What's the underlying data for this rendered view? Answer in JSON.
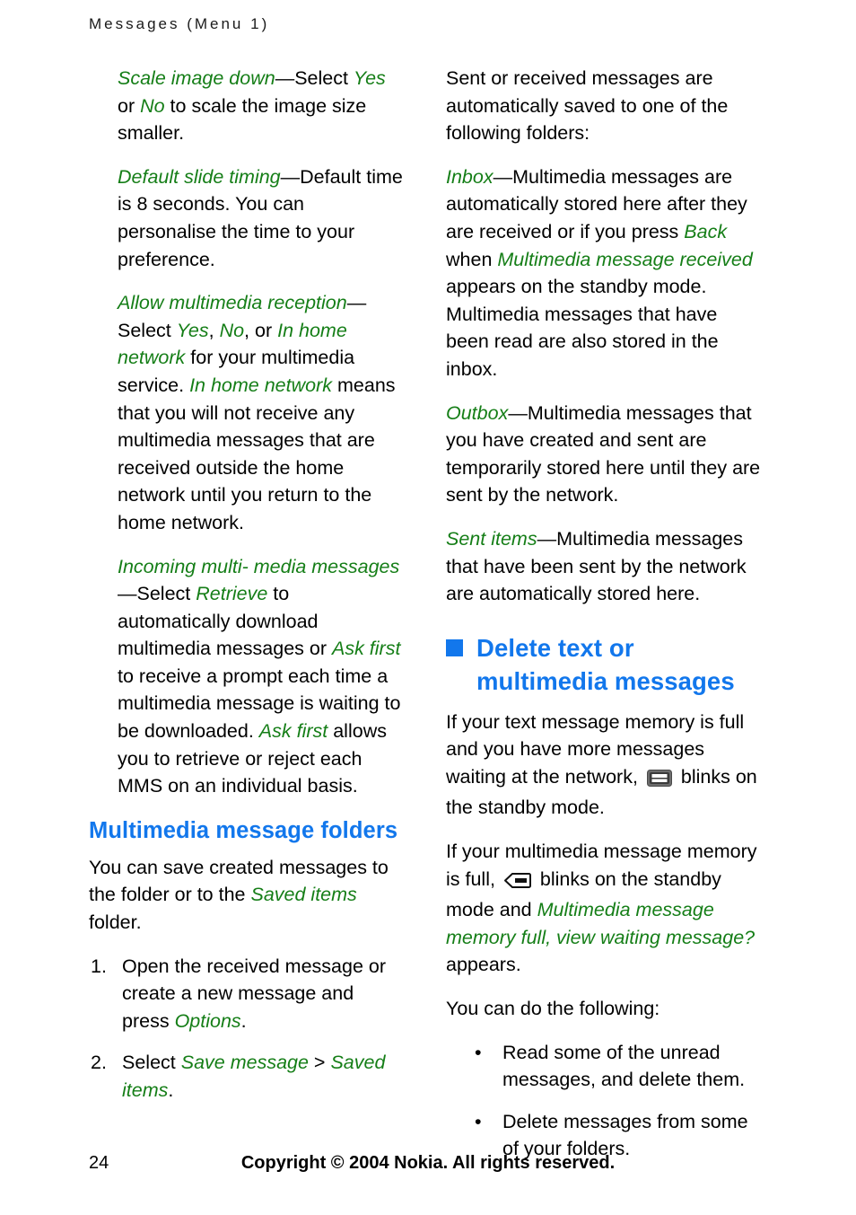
{
  "header": {
    "running_title": "Messages (Menu 1)"
  },
  "colors": {
    "green_term": "#157E17",
    "blue_heading": "#1277EC",
    "body_text": "#000000"
  },
  "left_column": {
    "paragraphs": [
      {
        "id": "scale-image-down",
        "term": "Scale image down",
        "dash": "—",
        "segments": [
          {
            "text": "Select ",
            "style": "normal"
          },
          {
            "text": "Yes",
            "style": "term"
          },
          {
            "text": " or ",
            "style": "normal"
          },
          {
            "text": "No",
            "style": "term"
          },
          {
            "text": " to scale the image size smaller.",
            "style": "normal"
          }
        ]
      },
      {
        "id": "default-slide-timing",
        "term": "Default slide timing",
        "dash": "—",
        "segments": [
          {
            "text": "Default time is 8 seconds. You can personalise the time to your preference.",
            "style": "normal"
          }
        ]
      },
      {
        "id": "allow-multimedia-reception",
        "term": "Allow multimedia reception",
        "dash": "—",
        "segments": [
          {
            "text": "Select ",
            "style": "normal"
          },
          {
            "text": "Yes",
            "style": "term"
          },
          {
            "text": ", ",
            "style": "normal"
          },
          {
            "text": "No",
            "style": "term"
          },
          {
            "text": ", or ",
            "style": "normal"
          },
          {
            "text": "In home network",
            "style": "term"
          },
          {
            "text": " for your multimedia service. ",
            "style": "normal"
          },
          {
            "text": "In home network",
            "style": "term"
          },
          {
            "text": " means that you will not receive any multimedia messages that are received outside the home network until you return to the home network.",
            "style": "normal"
          }
        ]
      },
      {
        "id": "incoming-multimedia-messages",
        "term": "Incoming multi- media messages",
        "dash": "—",
        "segments": [
          {
            "text": "Select ",
            "style": "normal"
          },
          {
            "text": "Retrieve",
            "style": "term"
          },
          {
            "text": " to automatically download multimedia messages or ",
            "style": "normal"
          },
          {
            "text": "Ask first",
            "style": "term"
          },
          {
            "text": " to receive a prompt each time a multimedia message is waiting to be downloaded. ",
            "style": "normal"
          },
          {
            "text": "Ask first",
            "style": "term"
          },
          {
            "text": " allows you to retrieve or reject each MMS on an individual basis.",
            "style": "normal"
          }
        ]
      }
    ],
    "section_heading": "Multimedia message folders",
    "intro_segments": [
      {
        "text": "You can save created messages to the folder or to the ",
        "style": "normal"
      },
      {
        "text": "Saved items",
        "style": "term"
      },
      {
        "text": " folder.",
        "style": "normal"
      }
    ],
    "steps": [
      {
        "marker": "1.",
        "segments": [
          {
            "text": "Open the received message or create a new message and press ",
            "style": "normal"
          },
          {
            "text": "Options",
            "style": "term"
          },
          {
            "text": ".",
            "style": "normal"
          }
        ]
      },
      {
        "marker": "2.",
        "segments": [
          {
            "text": "Select ",
            "style": "normal"
          },
          {
            "text": "Save message",
            "style": "term"
          },
          {
            "text": " > ",
            "style": "normal"
          },
          {
            "text": "Saved items",
            "style": "term"
          },
          {
            "text": ".",
            "style": "normal"
          }
        ]
      }
    ]
  },
  "right_column": {
    "intro": "Sent or received messages are automatically saved to one of the following folders:",
    "folders": [
      {
        "id": "inbox",
        "term": "Inbox",
        "dash": "—",
        "segments": [
          {
            "text": "Multimedia messages are automatically stored here after they are received or if you press ",
            "style": "normal"
          },
          {
            "text": "Back",
            "style": "term"
          },
          {
            "text": " when ",
            "style": "normal"
          },
          {
            "text": "Multimedia message received",
            "style": "term"
          },
          {
            "text": " appears on the standby mode. Multimedia messages that have been read are also stored in the inbox.",
            "style": "normal"
          }
        ]
      },
      {
        "id": "outbox",
        "term": "Outbox",
        "dash": "—",
        "segments": [
          {
            "text": "Multimedia messages that you have created and sent are temporarily stored here until they are sent by the network.",
            "style": "normal"
          }
        ]
      },
      {
        "id": "sent-items",
        "term": "Sent items",
        "dash": "—",
        "segments": [
          {
            "text": "Multimedia messages that have been sent by the network are automatically stored here.",
            "style": "normal"
          }
        ]
      }
    ],
    "chapter_heading": "Delete text or multimedia messages",
    "chapter_bullet_icon": "blue-square-bullet",
    "delete_para_1": {
      "before_icon": "If your text message memory is full and you have more messages waiting at the network, ",
      "icon": "sms-envelope-icon",
      "after_icon": " blinks on the standby mode."
    },
    "delete_para_2": {
      "before_icon": "If your multimedia message memory is full, ",
      "icon": "mms-envelope-icon",
      "after_icon_segments": [
        {
          "text": " blinks on the standby mode and ",
          "style": "normal"
        },
        {
          "text": "Multimedia message memory full, view waiting message?",
          "style": "term"
        },
        {
          "text": " appears.",
          "style": "normal"
        }
      ]
    },
    "following_intro": "You can do the following:",
    "bullets": [
      {
        "marker": "•",
        "text": "Read some of the unread messages, and delete them."
      },
      {
        "marker": "•",
        "text": "Delete messages from some of your folders."
      }
    ]
  },
  "footer": {
    "page_number": "24",
    "copyright": "Copyright © 2004 Nokia. All rights reserved."
  }
}
